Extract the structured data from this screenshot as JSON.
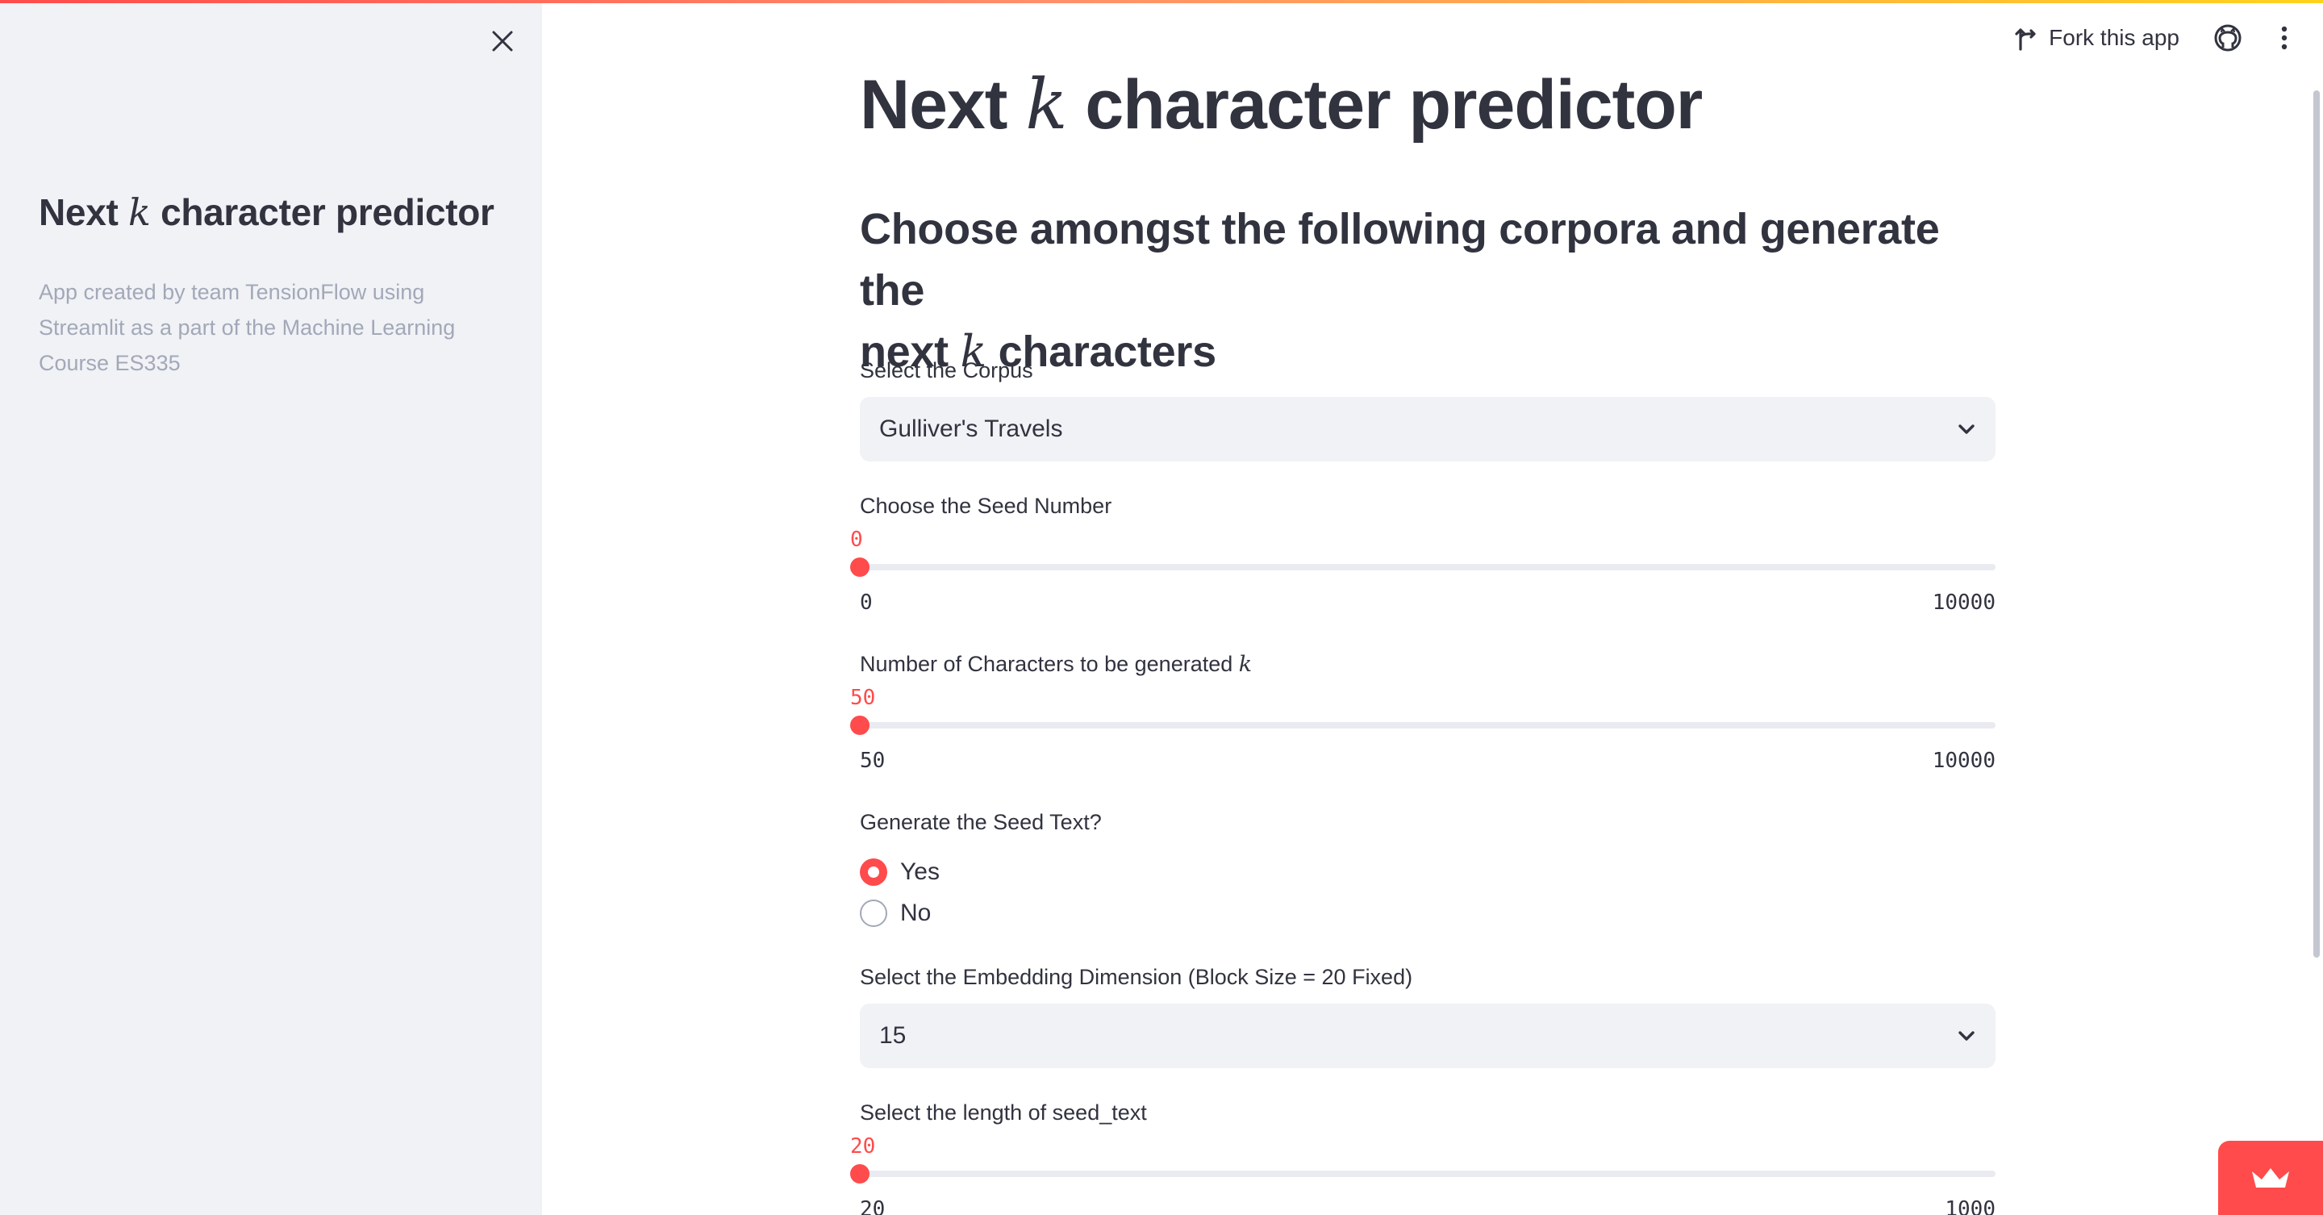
{
  "sidebar": {
    "title_prefix": "Next",
    "title_var": "k",
    "title_suffix": "character predictor",
    "description": "App created by team TensionFlow using Streamlit as a part of the Machine Learning Course ES335"
  },
  "header": {
    "fork_label": "Fork this app"
  },
  "main": {
    "title_prefix": "Next",
    "title_var": "k",
    "title_suffix": "character predictor",
    "subheader_line1": "Choose amongst the following corpora and generate the",
    "subheader_line2_prefix": "next",
    "subheader_var": "k",
    "subheader_line2_suffix": "characters",
    "corpus": {
      "label": "Select the Corpus",
      "value": "Gulliver's Travels"
    },
    "seed": {
      "label": "Choose the Seed Number",
      "value": "0",
      "min": "0",
      "max": "10000",
      "fraction": 0
    },
    "num_chars": {
      "label_prefix": "Number of Characters to be generated",
      "label_var": "k",
      "value": "50",
      "min": "50",
      "max": "10000",
      "fraction": 0
    },
    "gen_seed": {
      "label": "Generate the Seed Text?",
      "options": [
        "Yes",
        "No"
      ],
      "selected": "Yes"
    },
    "embedding": {
      "label": "Select the Embedding Dimension (Block Size = 20 Fixed)",
      "value": "15"
    },
    "seed_len": {
      "label": "Select the length of seed_text",
      "value": "20",
      "min": "20",
      "max": "1000",
      "fraction": 0
    }
  },
  "colors": {
    "accent": "#ff4b4b",
    "sidebar_bg": "#f0f2f6",
    "text": "#31333f",
    "muted_text": "#a3a8b8"
  }
}
